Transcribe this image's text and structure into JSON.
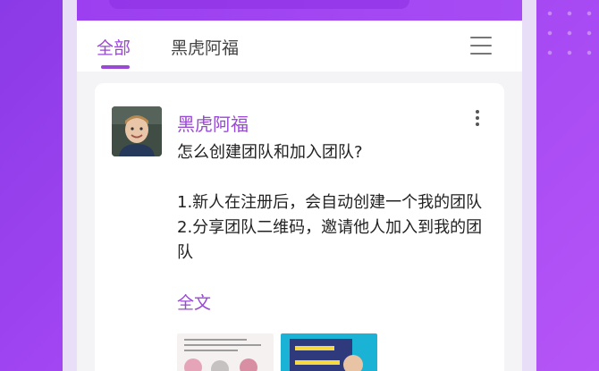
{
  "tabs": {
    "all_label": "全部",
    "user_label": "黑虎阿福",
    "active": "all"
  },
  "post": {
    "author": "黑虎阿福",
    "title": "怎么创建团队和加入团队?",
    "lines": [
      "1.新人在注册后，会自动创建一个我的团队",
      "2.分享团队二维码，邀请他人加入到我的团队"
    ],
    "full_text_link": "全文",
    "images": [
      "post-image-1",
      "post-image-2"
    ]
  },
  "icons": {
    "menu": "hamburger-menu-icon",
    "more": "more-vertical-icon"
  },
  "colors": {
    "accent": "#9a48d6",
    "background": "#a246f2",
    "text": "#222222"
  }
}
